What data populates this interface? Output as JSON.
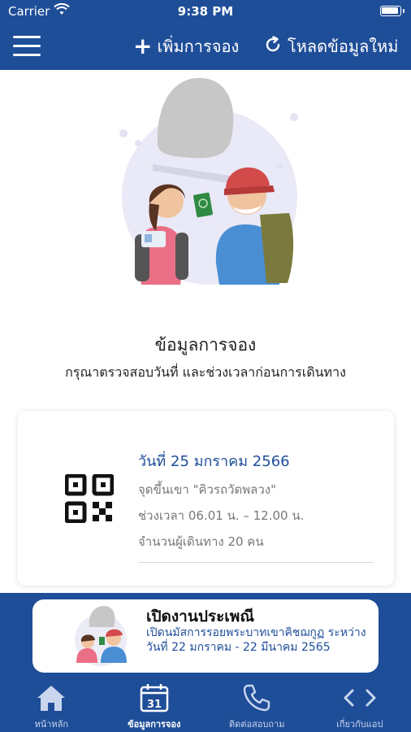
{
  "status_bar": {
    "carrier": "Carrier",
    "time": "9:38 PM"
  },
  "navbar": {
    "add_booking_label": "เพิ่มการจอง",
    "reload_label": "โหลดข้อมูลใหม่"
  },
  "section": {
    "title": "ข้อมูลการจอง",
    "subtitle": "กรุณาตรวจสอบวันที่ และช่วงเวลาก่อนการเดินทาง"
  },
  "booking": {
    "date": "วันที่ 25 มกราคม 2566",
    "pickup_point": "จุดขึ้นเขา \"คิวรถวัดพลวง\"",
    "time_slot": "ช่วงเวลา 06.01 น. – 12.00 น.",
    "travelers": "จำนวนผู้เดินทาง 20 คน"
  },
  "promo": {
    "title": "เปิดงานประเพณี",
    "description": "เปิดนมัสการรอยพระบาทเขาคิชฌกูฏ ระหว่างวันที่ 22 มกราคม - 22 มีนาคม 2565"
  },
  "tabs": [
    {
      "label": "หน้าหลัก",
      "icon": "home-icon"
    },
    {
      "label": "ข้อมูลการจอง",
      "icon": "calendar-icon",
      "calendar_day": "31",
      "active": true
    },
    {
      "label": "ติดต่อสอบถาม",
      "icon": "phone-icon"
    },
    {
      "label": "เกี่ยวกับแอป",
      "icon": "code-icon"
    }
  ],
  "colors": {
    "brand_blue": "#1f4e99",
    "background": "#ffffff"
  }
}
